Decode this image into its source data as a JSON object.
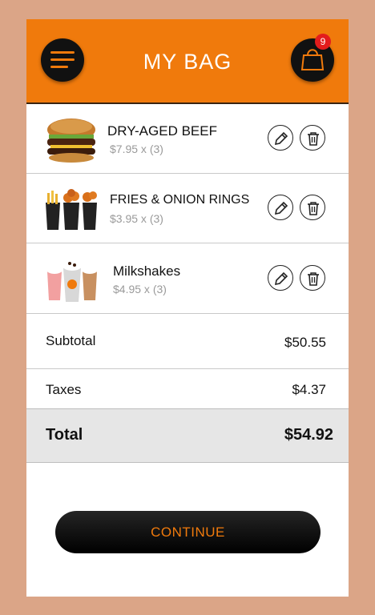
{
  "header": {
    "title": "MY BAG",
    "cart_count": "9",
    "accent": "#f07a0c"
  },
  "items": [
    {
      "name": "DRY-AGED BEEF",
      "price": "$7.95 x (3)",
      "image": "burger-image"
    },
    {
      "name": "FRIES & ONION RINGS",
      "price": "$3.95 x (3)",
      "image": "fries-image"
    },
    {
      "name": "Milkshakes",
      "price": "$4.95 x (3)",
      "image": "milkshake-image"
    }
  ],
  "summary": {
    "subtotal_label": "Subtotal",
    "subtotal_value": "$50.55",
    "taxes_label": "Taxes",
    "taxes_value": "$4.37",
    "total_label": "Total",
    "total_value": "$54.92"
  },
  "continue_label": "CONTINUE"
}
